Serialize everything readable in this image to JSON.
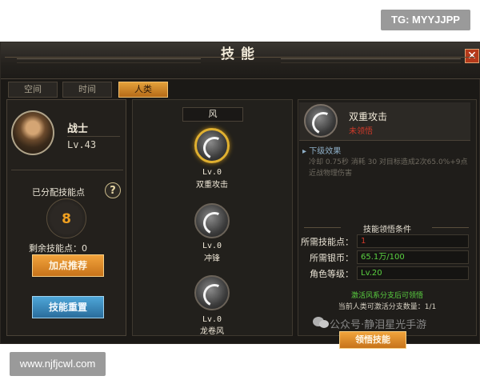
{
  "overlay": {
    "tg_badge": "TG: MYYJJPP",
    "url_badge": "www.njfjcwl.com"
  },
  "window": {
    "title": "技能",
    "close_icon": "close-icon"
  },
  "tabs": [
    {
      "label": "空间",
      "active": false
    },
    {
      "label": "时间",
      "active": false
    },
    {
      "label": "人类",
      "active": true
    }
  ],
  "character": {
    "name": "战士",
    "level": "Lv.43"
  },
  "points": {
    "allocated_label": "已分配技能点",
    "allocated_value": "8",
    "remaining_label": "剩余技能点：0",
    "help_icon": "question-icon"
  },
  "buttons": {
    "recommend": "加点推荐",
    "reset": "技能重置"
  },
  "tree": {
    "category": "风",
    "skills": [
      {
        "level": "Lv.0",
        "name": "双重攻击",
        "selected": true
      },
      {
        "level": "Lv.0",
        "name": "冲锋",
        "selected": false
      },
      {
        "level": "Lv.0",
        "name": "龙卷风",
        "selected": false
      }
    ]
  },
  "detail": {
    "name": "双重攻击",
    "status": "未领悟",
    "next_level_label": "▸ 下级效果",
    "description": "冷却 0.75秒 消耗 30 对目标造成2次65.0%+9点近战物理伤害"
  },
  "conditions": {
    "title": "技能领悟条件",
    "rows": [
      {
        "label": "所需技能点：",
        "value": "1",
        "color": "#d23a2a"
      },
      {
        "label": "所需银币：",
        "value": "65.1万/100",
        "color": "#5ad040"
      },
      {
        "label": "角色等级：",
        "value": "Lv.20",
        "color": "#5ad040"
      }
    ],
    "note_green": "激活风系分支后可领悟",
    "note_grey": "当前人类可激活分支数量：1/1",
    "learn_button": "领悟技能"
  },
  "watermark": "公众号·静泪星光手游",
  "colors": {
    "accent_orange": "#e3a13a",
    "accent_blue": "#4ea6d8",
    "status_red": "#d23a2a",
    "status_green": "#5ad040",
    "select_gold": "#e0b030"
  }
}
